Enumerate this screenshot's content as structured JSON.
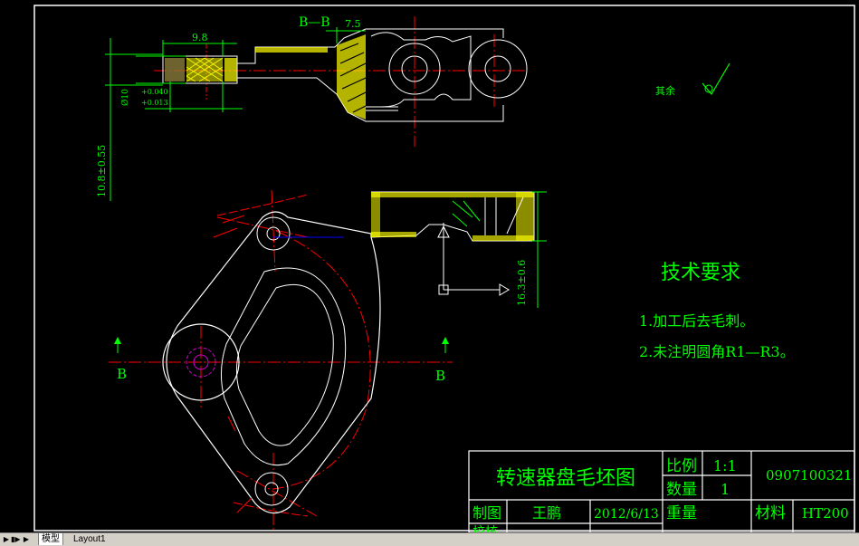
{
  "section_label": "B—B",
  "dims": {
    "d75": "7.5",
    "d98": "9.8",
    "d10": "Ø10",
    "tol_upper": "+0.040",
    "tol_lower": "+0.013",
    "d108": "10.8±0.55",
    "d163": "16.3±0.6"
  },
  "section_markers": {
    "left": "B",
    "right": "B"
  },
  "surface_finish": "其余",
  "tech_requirements": {
    "title": "技术要求",
    "items": [
      "1.加工后去毛刺。",
      "2.未注明圆角R1—R3。"
    ]
  },
  "title_block": {
    "title": "转速器盘毛坯图",
    "scale_label": "比例",
    "scale_value": "1:1",
    "qty_label": "数量",
    "qty_value": "1",
    "drawing_no": "0907100321",
    "drawn_label": "制图",
    "drawn_by": "王鹏",
    "date": "2012/6/13",
    "weight_label": "重量",
    "material_label": "材料",
    "material_value": "HT200",
    "check_label": "校核"
  },
  "tabs": {
    "model": "模型",
    "layout": "Layout1"
  },
  "colors": {
    "background": "#000000",
    "outline": "#ffffff",
    "dimension": "#00ff00",
    "centerline": "#ff0000",
    "hatch": "#ffff00",
    "frame": "#ffffff"
  }
}
